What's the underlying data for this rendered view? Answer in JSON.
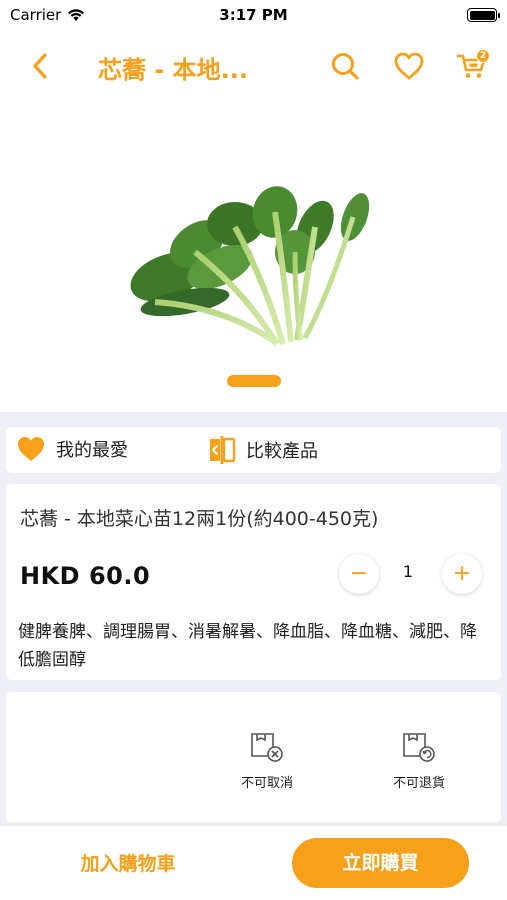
{
  "status_bar": {
    "carrier": "Carrier",
    "time": "3:17 PM"
  },
  "nav": {
    "title": "芯蕎 - 本地...",
    "cart_count": "2",
    "icons": [
      "back-chevron-icon",
      "search-icon",
      "heart-icon",
      "cart-icon"
    ]
  },
  "gallery": {
    "page_count": 1,
    "active_page": 1
  },
  "actions": {
    "favorite_label": "我的最愛",
    "compare_label": "比較產品"
  },
  "product": {
    "name": "芯蕎 - 本地菜心苗12兩1份(約400-450克)",
    "price": "HKD 60.0",
    "quantity": "1",
    "minus": "−",
    "plus": "+",
    "description": "健脾養脾、調理腸胃、消暑解暑、降血脂、降血糖、減肥、降低膽固醇"
  },
  "policies": {
    "no_cancel": "不可取消",
    "no_return": "不可退貨"
  },
  "bottom": {
    "add_to_cart": "加入購物車",
    "buy_now": "立即購買"
  },
  "colors": {
    "accent": "#f7a01a",
    "background": "#eef0f6",
    "card": "#ffffff"
  }
}
